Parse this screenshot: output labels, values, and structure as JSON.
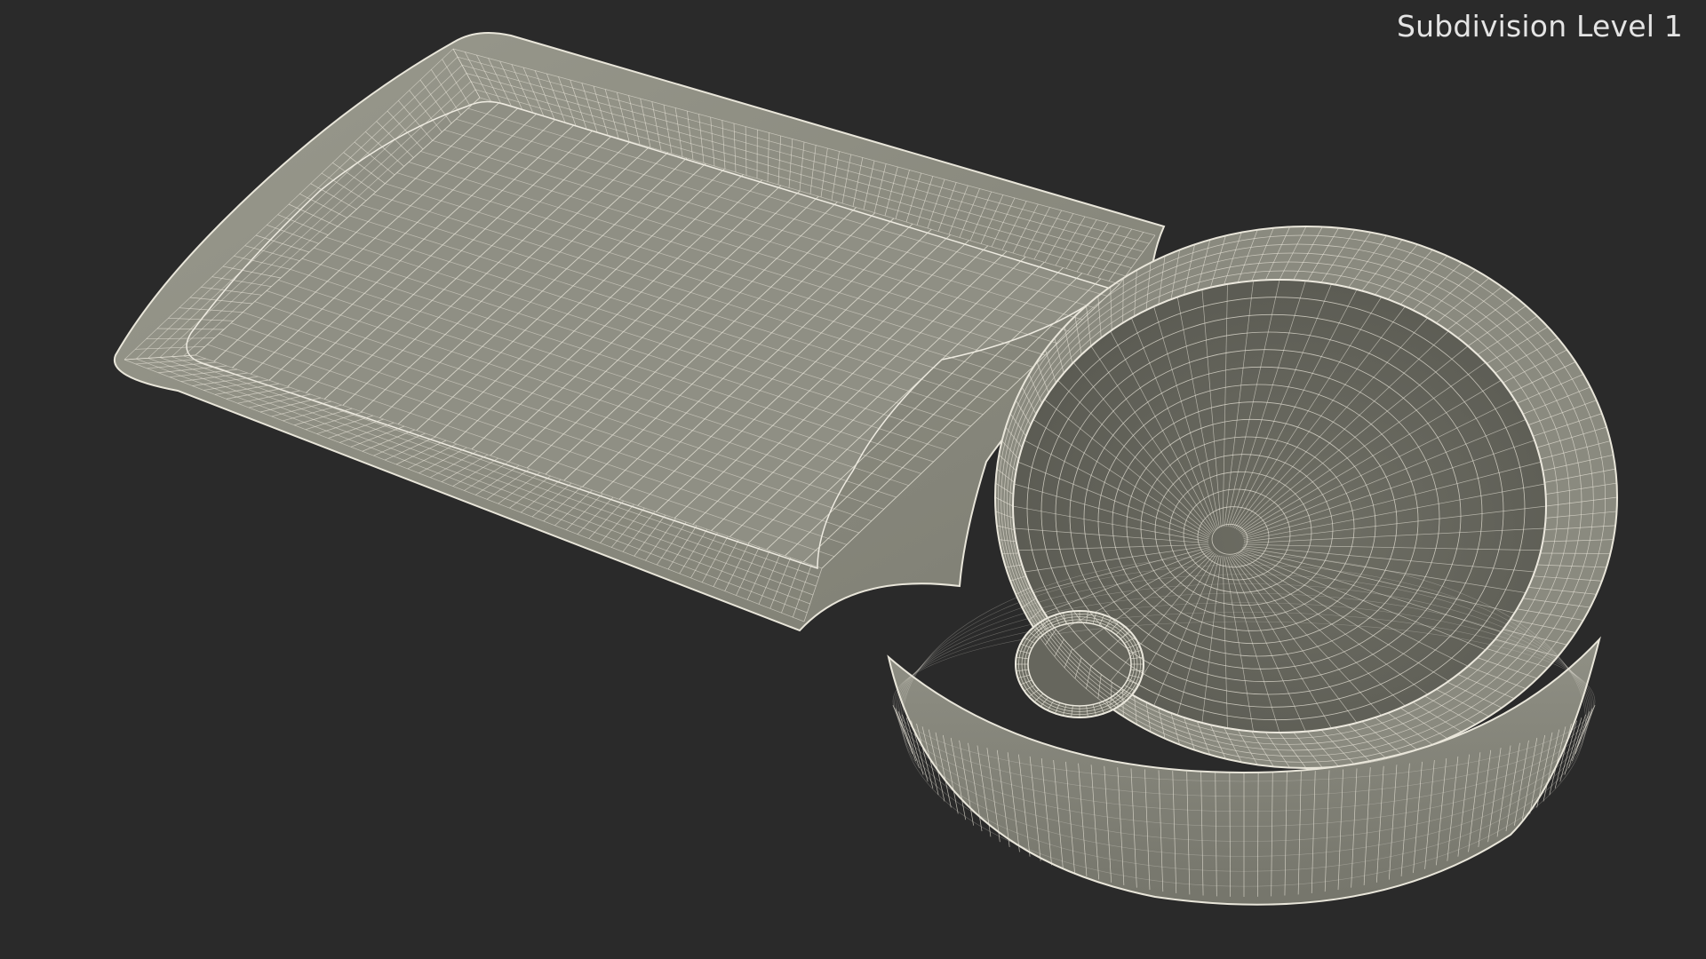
{
  "render": {
    "label": "Subdivision Level 1",
    "subject": "sink-wireframe",
    "colors": {
      "background": "#2a2a2a",
      "surface": "#8a8a7e",
      "surface_dark": "#6c6c62",
      "wire": "#e9e6da",
      "label": "#e4e4e4"
    }
  }
}
